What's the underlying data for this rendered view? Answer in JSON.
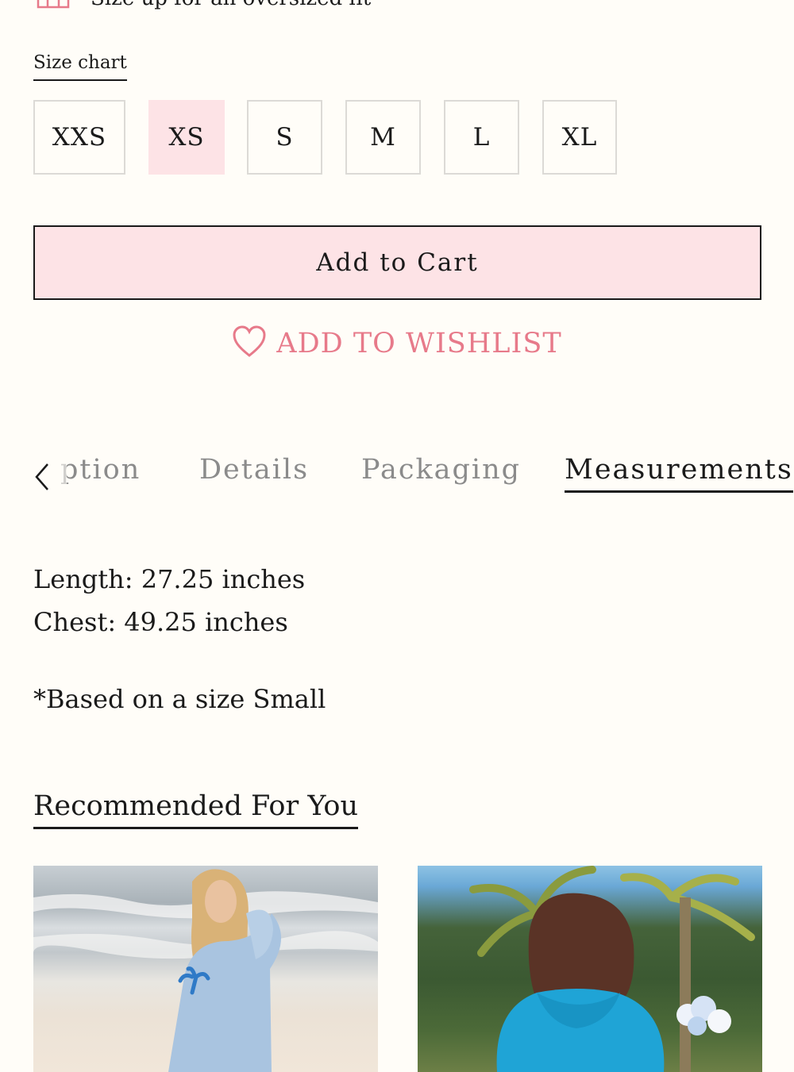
{
  "fit_note": {
    "text": "Size up for an oversized fit",
    "icon": "hoodie-icon"
  },
  "size_chart": {
    "label": "Size chart"
  },
  "sizes": {
    "options": [
      "XXS",
      "XS",
      "S",
      "M",
      "L",
      "XL"
    ],
    "selected": "XS"
  },
  "cart": {
    "label": "Add to Cart"
  },
  "wishlist": {
    "label": "ADD TO WISHLIST",
    "icon": "heart-icon"
  },
  "tabs": {
    "prev_icon": "chevron-left-icon",
    "items": [
      {
        "label": "Description",
        "visible_text": "ption"
      },
      {
        "label": "Details"
      },
      {
        "label": "Packaging"
      },
      {
        "label": "Measurements",
        "active": true
      }
    ]
  },
  "measurements": {
    "length": "Length: 27.25 inches",
    "chest": "Chest: 49.25 inches",
    "note": "*Based on a size Small"
  },
  "recommended": {
    "title": "Recommended For You",
    "products": [
      {
        "image": "woman-on-beach-light-blue-hoodie-palm-tree"
      },
      {
        "image": "person-back-turquoise-hoodie-palm-trees"
      }
    ]
  },
  "colors": {
    "background": "#fffdf8",
    "accent_pink": "#fde3e6",
    "wishlist_pink": "#e77a8a",
    "text": "#1a1a1a",
    "inactive_tab": "#8b8b8b"
  }
}
